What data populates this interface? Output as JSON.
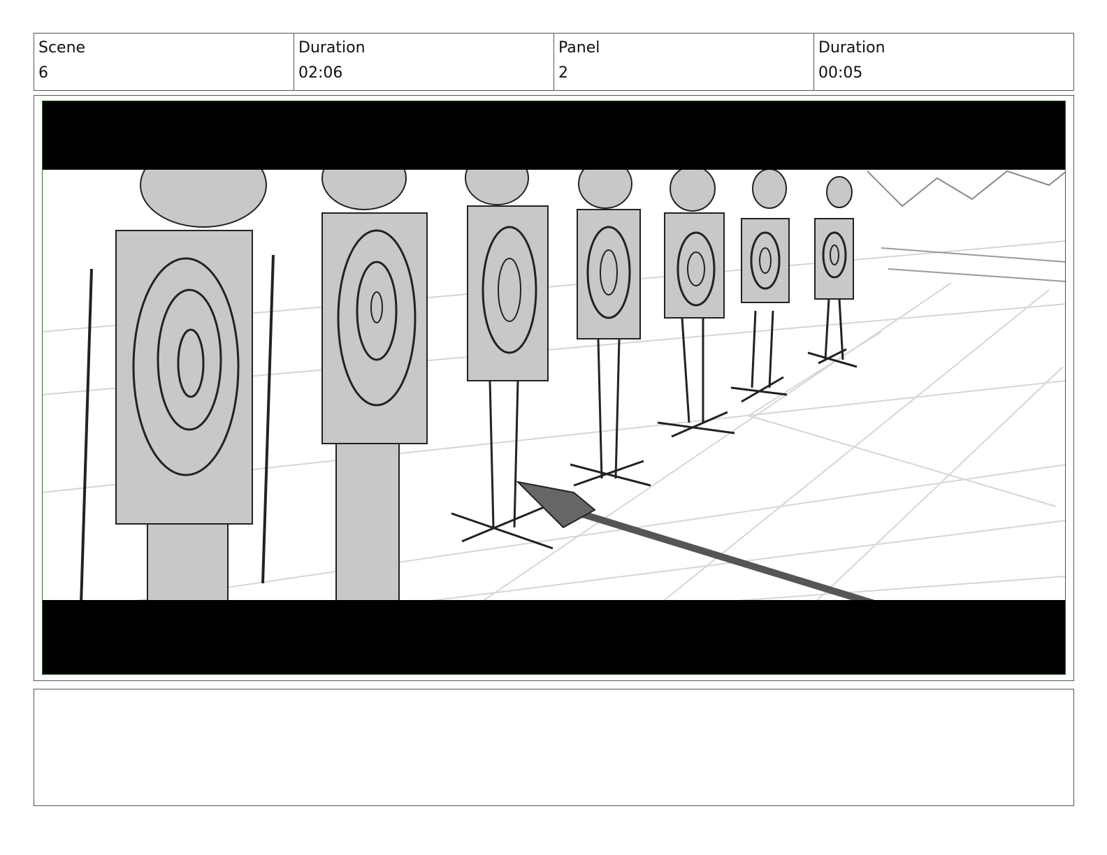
{
  "header": {
    "scene_label": "Scene",
    "scene_value": "6",
    "scene_duration_label": "Duration",
    "scene_duration_value": "02:06",
    "panel_label": "Panel",
    "panel_value": "2",
    "panel_duration_label": "Duration",
    "panel_duration_value": "00:05"
  },
  "notes": {
    "text": ""
  },
  "colors": {
    "frame_border": "#2e6b2e",
    "letterbox": "#000000",
    "sketch_fill": "#c8c8c8"
  }
}
